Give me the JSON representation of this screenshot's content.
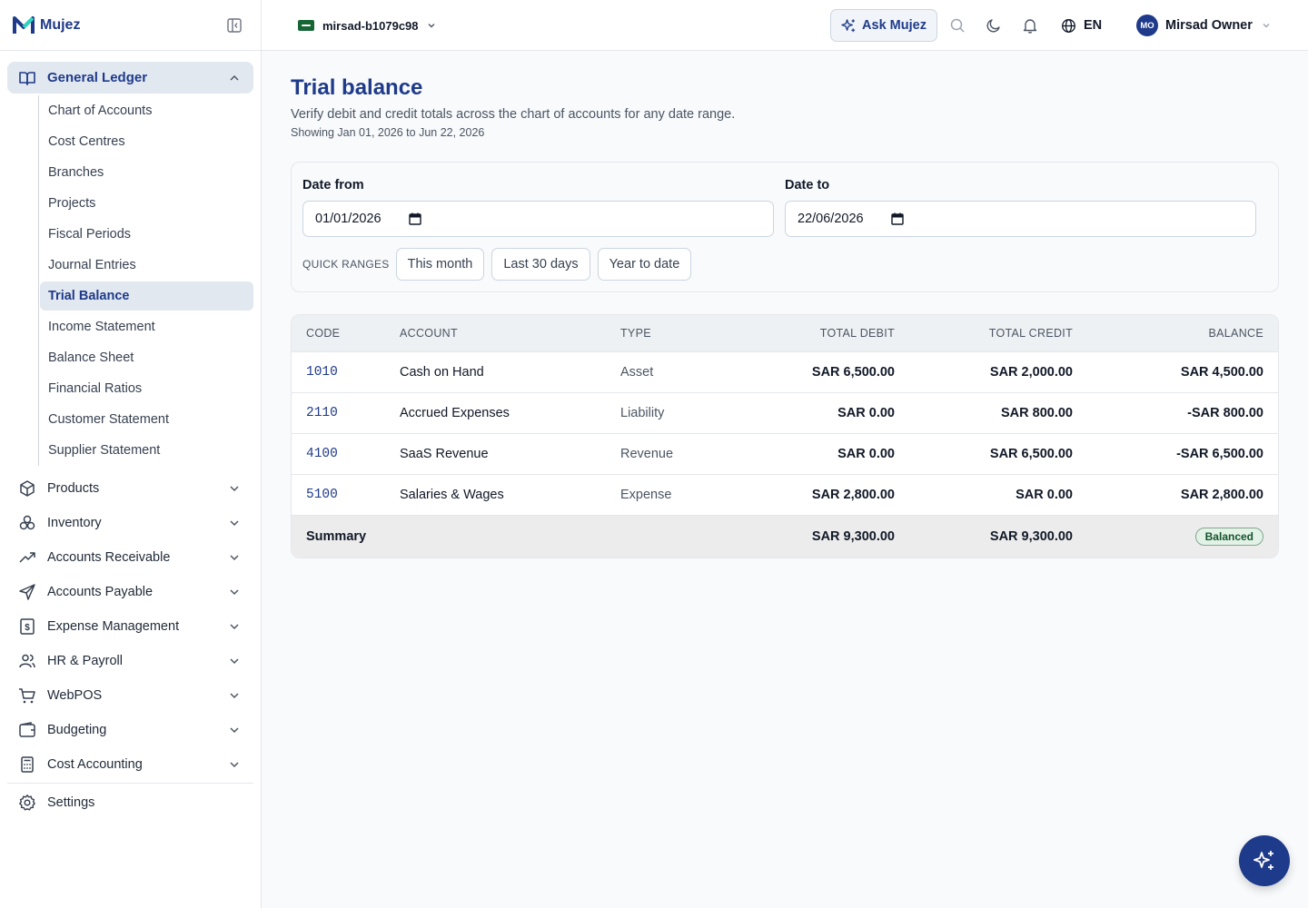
{
  "brand": {
    "name": "Mujez"
  },
  "sidebar": {
    "group": {
      "label": "General Ledger",
      "items": [
        {
          "label": "Chart of Accounts"
        },
        {
          "label": "Cost Centres"
        },
        {
          "label": "Branches"
        },
        {
          "label": "Projects"
        },
        {
          "label": "Fiscal Periods"
        },
        {
          "label": "Journal Entries"
        },
        {
          "label": "Trial Balance"
        },
        {
          "label": "Income Statement"
        },
        {
          "label": "Balance Sheet"
        },
        {
          "label": "Financial Ratios"
        },
        {
          "label": "Customer Statement"
        },
        {
          "label": "Supplier Statement"
        }
      ]
    },
    "items": [
      {
        "label": "Products",
        "icon": "box-icon"
      },
      {
        "label": "Inventory",
        "icon": "boxes-icon"
      },
      {
        "label": "Accounts Receivable",
        "icon": "trending-up-icon"
      },
      {
        "label": "Accounts Payable",
        "icon": "send-icon"
      },
      {
        "label": "Expense Management",
        "icon": "receipt-icon"
      },
      {
        "label": "HR & Payroll",
        "icon": "users-icon"
      },
      {
        "label": "WebPOS",
        "icon": "cart-icon"
      },
      {
        "label": "Budgeting",
        "icon": "wallet-icon"
      },
      {
        "label": "Cost Accounting",
        "icon": "calculator-icon"
      }
    ],
    "settings": {
      "label": "Settings"
    }
  },
  "topbar": {
    "workspace": "mirsad-b1079c98",
    "ask_label": "Ask Mujez",
    "language": "EN",
    "user": {
      "initials": "MO",
      "name": "Mirsad Owner"
    }
  },
  "page": {
    "title": "Trial balance",
    "description": "Verify debit and credit totals across the chart of accounts for any date range.",
    "range_text": "Showing Jan 01, 2026 to Jun 22, 2026"
  },
  "filters": {
    "date_from_label": "Date from",
    "date_from_value": "01/01/2026",
    "date_to_label": "Date to",
    "date_to_value": "22/06/2026",
    "quick_label": "QUICK RANGES",
    "quick_ranges": [
      "This month",
      "Last 30 days",
      "Year to date"
    ]
  },
  "table": {
    "headers": {
      "code": "CODE",
      "account": "ACCOUNT",
      "type": "TYPE",
      "debit": "TOTAL DEBIT",
      "credit": "TOTAL CREDIT",
      "balance": "BALANCE"
    },
    "rows": [
      {
        "code": "1010",
        "account": "Cash on Hand",
        "type": "Asset",
        "debit": "SAR 6,500.00",
        "credit": "SAR 2,000.00",
        "balance": "SAR 4,500.00"
      },
      {
        "code": "2110",
        "account": "Accrued Expenses",
        "type": "Liability",
        "debit": "SAR 0.00",
        "credit": "SAR 800.00",
        "balance": "-SAR 800.00"
      },
      {
        "code": "4100",
        "account": "SaaS Revenue",
        "type": "Revenue",
        "debit": "SAR 0.00",
        "credit": "SAR 6,500.00",
        "balance": "-SAR 6,500.00"
      },
      {
        "code": "5100",
        "account": "Salaries & Wages",
        "type": "Expense",
        "debit": "SAR 2,800.00",
        "credit": "SAR 0.00",
        "balance": "SAR 2,800.00"
      }
    ],
    "summary": {
      "label": "Summary",
      "debit": "SAR 9,300.00",
      "credit": "SAR 9,300.00",
      "status": "Balanced"
    }
  },
  "colors": {
    "accent": "#1e3a8a",
    "balanced": "#14532d"
  }
}
